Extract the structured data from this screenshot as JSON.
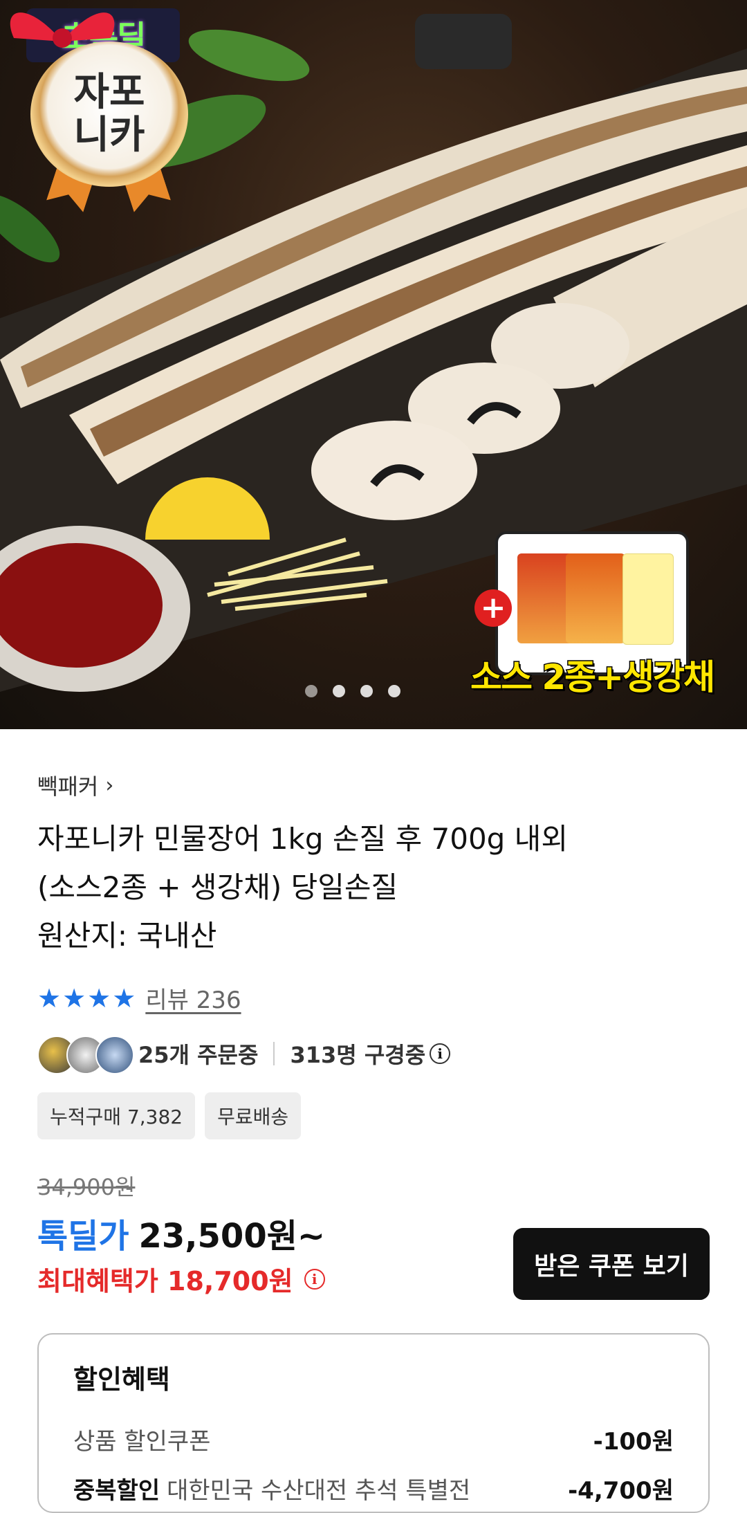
{
  "hero": {
    "badge_text": "초톡딜",
    "medal_text": "자포\n니카",
    "gift_caption": "소스 2종+생강채",
    "plus_symbol": "+",
    "carousel_dots": 4
  },
  "product": {
    "seller": "빽패커",
    "title_lines": [
      "자포니카 민물장어 1kg 손질 후 700g 내외",
      "(소스2종 + 생강채) 당일손질",
      "원산지: 국내산"
    ],
    "rating_stars": 4,
    "review_label": "리뷰 236",
    "ordering_text": "25개 주문중",
    "browsing_text": "313명 구경중",
    "tags": [
      "누적구매 7,382",
      "무료배송"
    ]
  },
  "price": {
    "original": "34,900원",
    "deal_label": "톡딜가",
    "deal_price": "23,500원~",
    "max_benefit": "최대혜택가 18,700원",
    "coupon_button": "받은 쿠폰 보기"
  },
  "benefit": {
    "title": "할인혜택",
    "rows": [
      {
        "label_bold": "",
        "label": "상품 할인쿠폰",
        "amount": "-100원"
      },
      {
        "label_bold": "중복할인",
        "label": "대한민국 수산대전 추석 특별전",
        "amount": "-4,700원"
      }
    ]
  },
  "colors": {
    "accent_blue": "#1f74e6",
    "sale_red": "#e52a2a",
    "button_black": "#111111"
  },
  "icons": [
    "chevron-right-icon",
    "star-icon",
    "info-icon",
    "plus-icon"
  ]
}
